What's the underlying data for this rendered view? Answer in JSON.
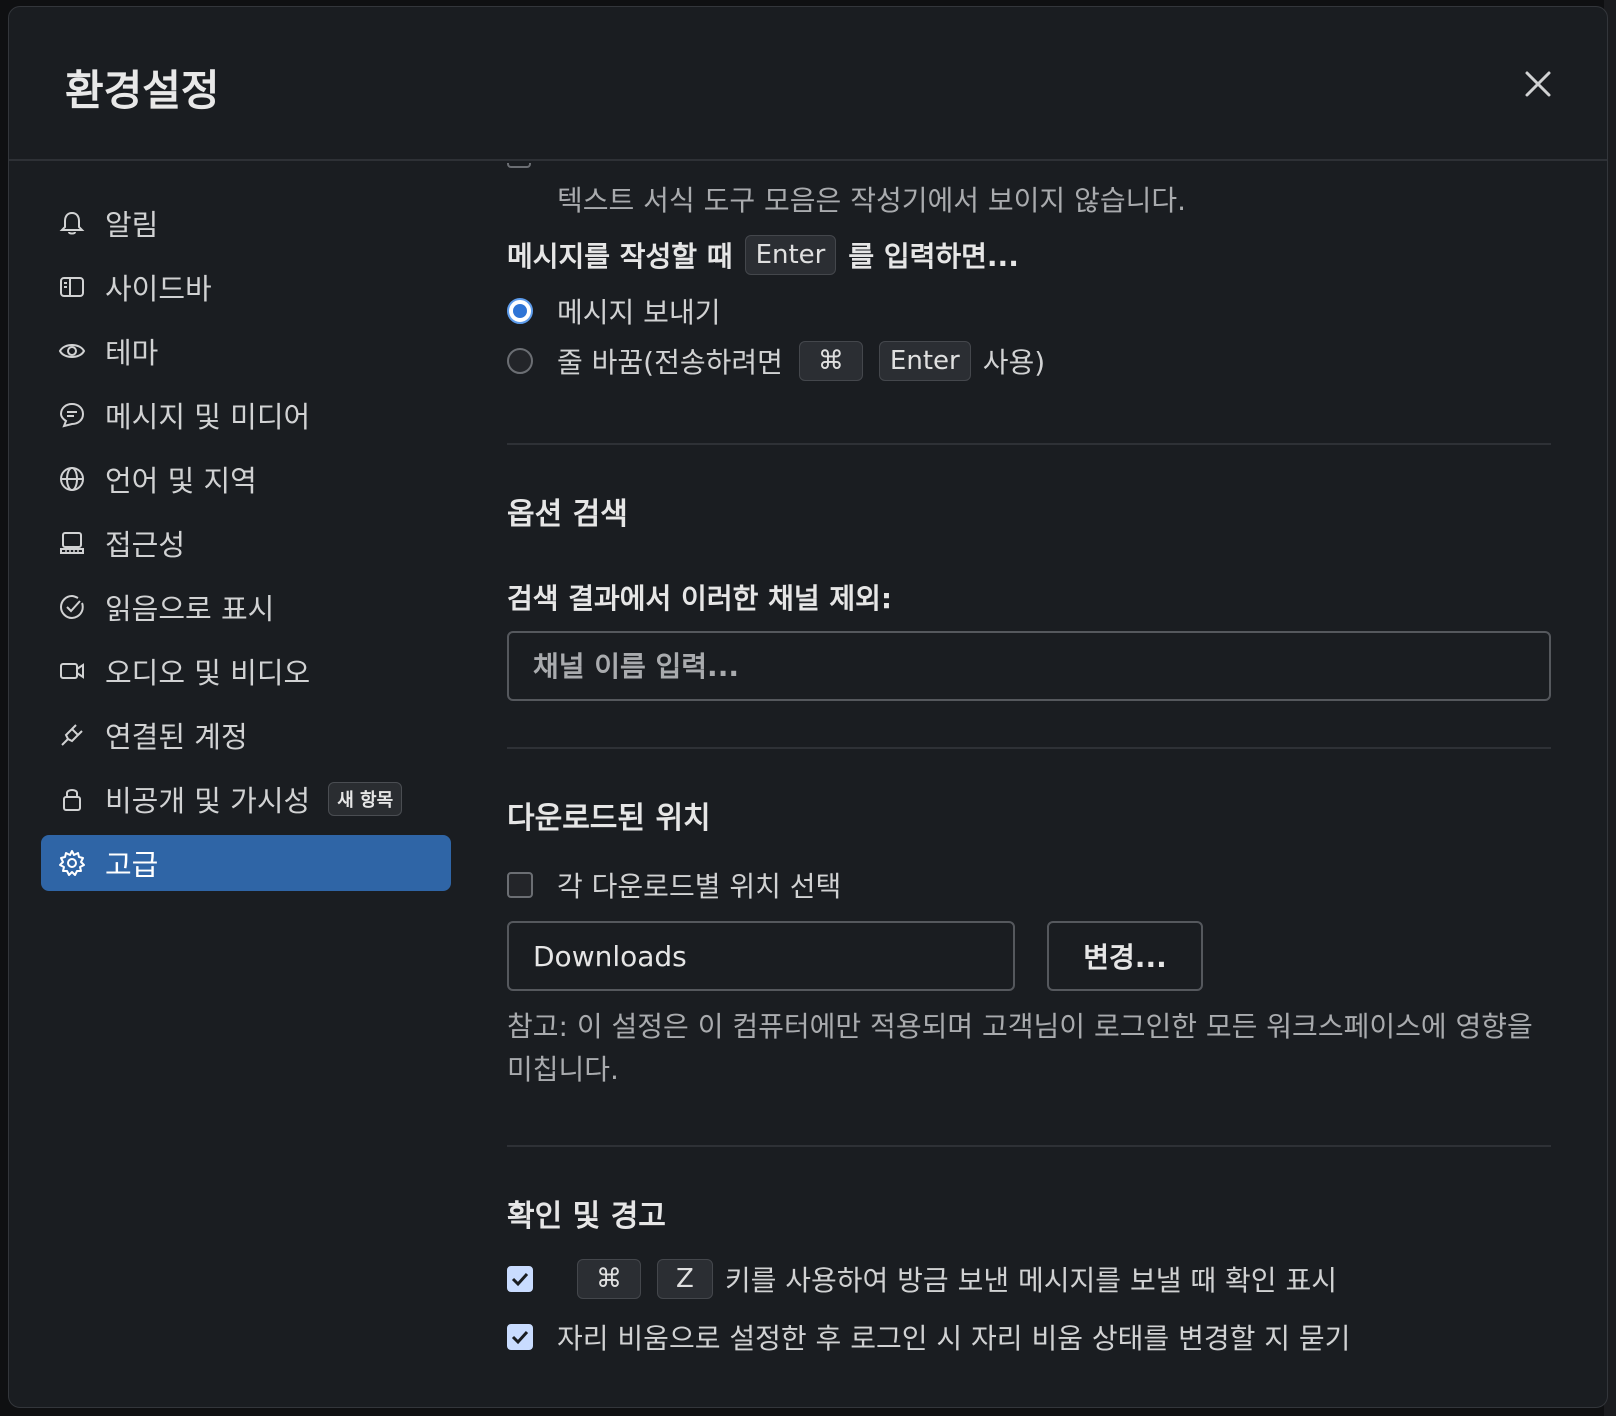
{
  "modal": {
    "title": "환경설정"
  },
  "sidebar": {
    "items": [
      {
        "label": "알림",
        "icon": "bell-icon"
      },
      {
        "label": "사이드바",
        "icon": "sidebar-icon"
      },
      {
        "label": "테마",
        "icon": "eye-icon"
      },
      {
        "label": "메시지 및 미디어",
        "icon": "message-icon"
      },
      {
        "label": "언어 및 지역",
        "icon": "globe-icon"
      },
      {
        "label": "접근성",
        "icon": "keyboard-icon"
      },
      {
        "label": "읽음으로 표시",
        "icon": "check-circle-icon"
      },
      {
        "label": "오디오 및 비디오",
        "icon": "video-icon"
      },
      {
        "label": "연결된 계정",
        "icon": "plug-icon"
      },
      {
        "label": "비공개 및 가시성",
        "icon": "lock-icon",
        "badge": "새 항목"
      },
      {
        "label": "고급",
        "icon": "gear-icon",
        "active": true
      }
    ]
  },
  "content": {
    "toolbar_note": "텍스트 서식 도구 모음은 작성기에서 보이지 않습니다.",
    "enter_heading": {
      "before": "메시지를 작성할 때",
      "key": "Enter",
      "after": "를 입력하면..."
    },
    "enter_options": [
      {
        "label": "메시지 보내기",
        "selected": true
      },
      {
        "label_before": "줄 바꿈(전송하려면",
        "keys": [
          "⌘",
          "Enter"
        ],
        "label_after": "사용)",
        "selected": false
      }
    ],
    "search_section": {
      "title": "옵션 검색",
      "exclude_label": "검색 결과에서 이러한 채널 제외:",
      "placeholder": "채널 이름 입력..."
    },
    "download_section": {
      "title": "다운로드된 위치",
      "ask_label": "각 다운로드별 위치 선택",
      "path": "Downloads",
      "change_button": "변경...",
      "note": "참고: 이 설정은 이 컴퓨터에만 적용되며 고객님이 로그인한 모든 워크스페이스에 영향을 미칩니다."
    },
    "confirm_section": {
      "title": "확인 및 경고",
      "undo_keys": [
        "⌘",
        "Z"
      ],
      "undo_label": "키를 사용하여 방금 보낸 메시지를 보낼 때 확인 표시",
      "away_label": "자리 비움으로 설정한 후 로그인 시 자리 비움 상태를 변경할 지 묻기"
    }
  },
  "colors": {
    "accent": "#2f65a6",
    "check": "#c9dcff",
    "background": "#1a1d21"
  }
}
